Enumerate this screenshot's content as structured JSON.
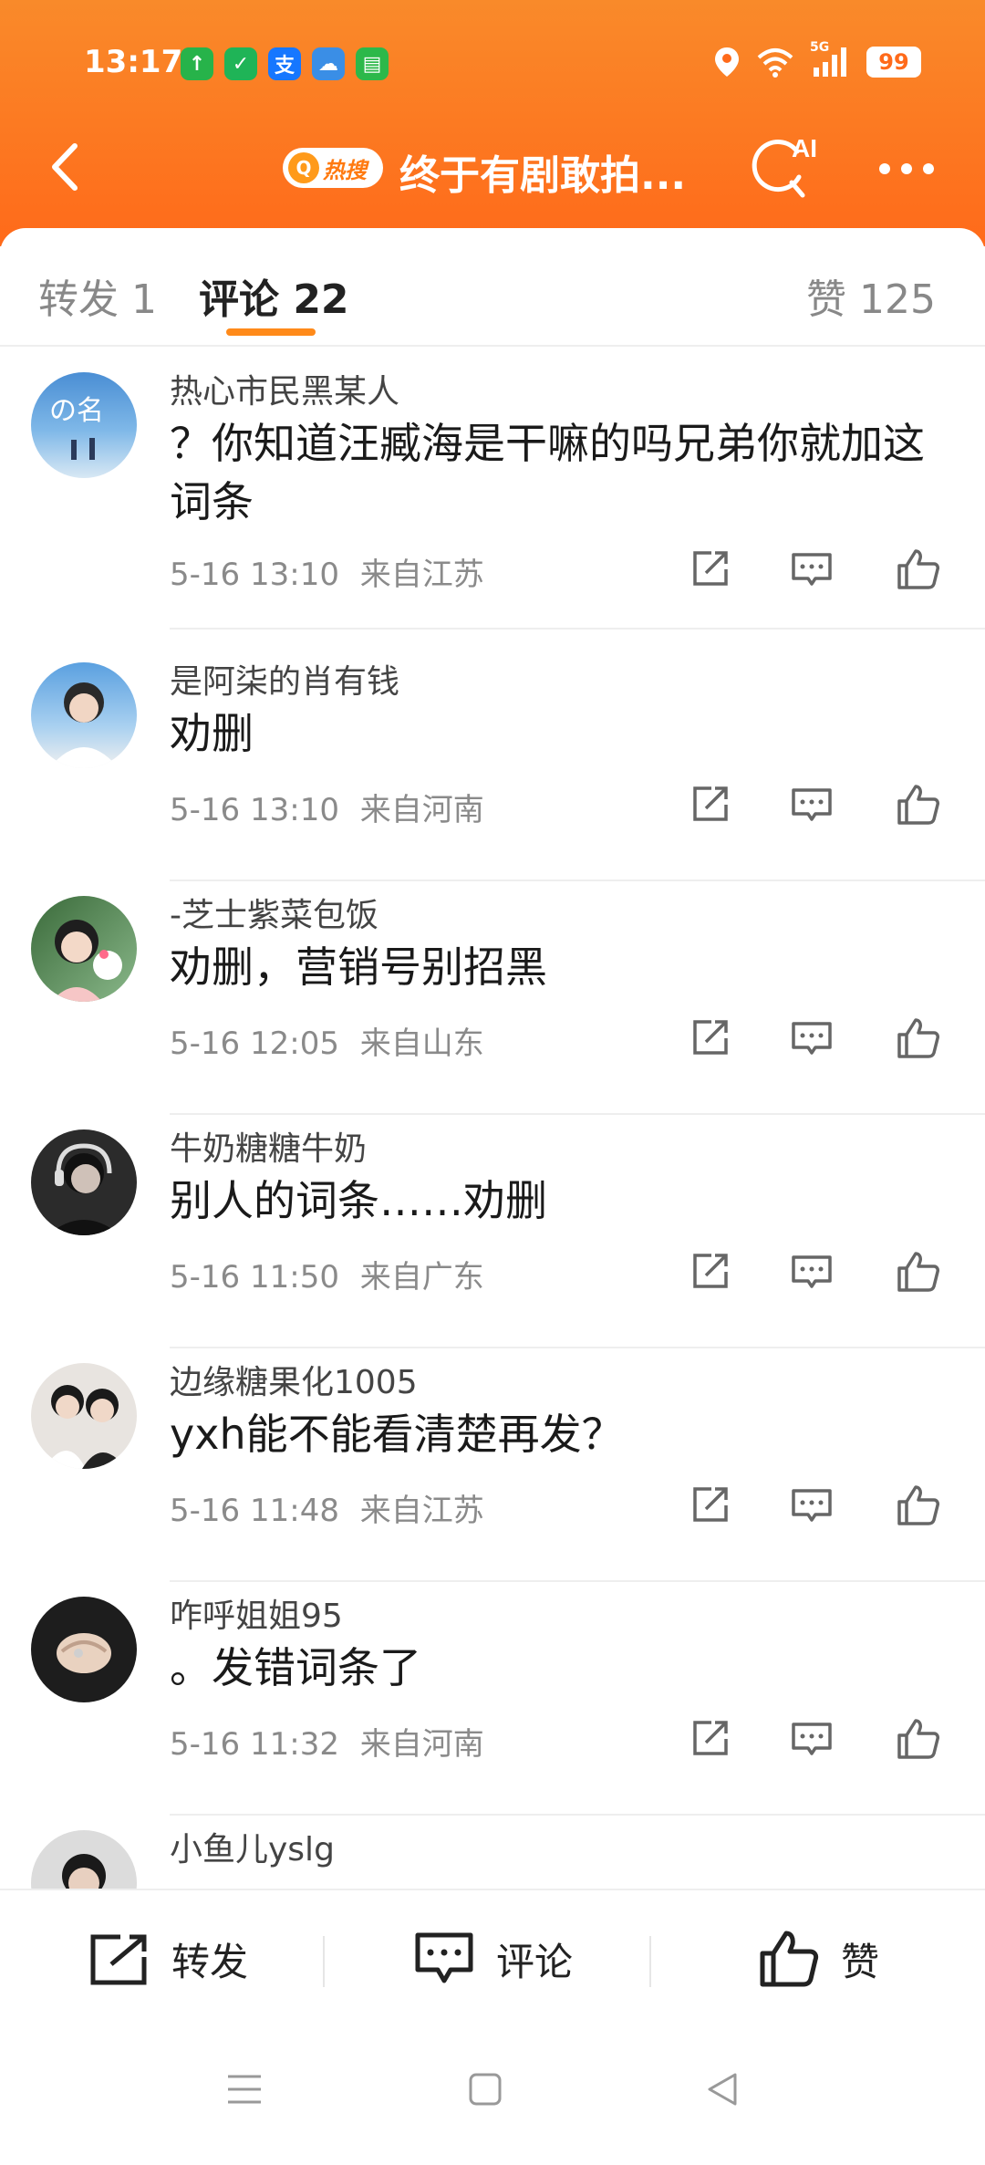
{
  "status_bar": {
    "time": "13:17",
    "battery": "99",
    "network": "5G"
  },
  "nav": {
    "hot_label": "热搜",
    "title": "终于有剧敢拍...",
    "ai_label": "AI"
  },
  "tabs": {
    "repost": "转发 1",
    "comments": "评论 22",
    "likes": "赞 125"
  },
  "comments": [
    {
      "user": "热心市民黑某人",
      "text": "？你知道汪臧海是干嘛的吗兄弟你就加这词条",
      "time": "5-16 13:10",
      "location": "来自江苏"
    },
    {
      "user": "是阿柒的肖有钱",
      "text": "劝删",
      "time": "5-16 13:10",
      "location": "来自河南"
    },
    {
      "user": "-芝士紫菜包饭",
      "text": "劝删，营销号别招黑",
      "time": "5-16 12:05",
      "location": "来自山东"
    },
    {
      "user": "牛奶糖糖牛奶",
      "text": "别人的词条……劝删",
      "time": "5-16 11:50",
      "location": "来自广东"
    },
    {
      "user": "边缘糖果化1005",
      "text": "yxh能不能看清楚再发？",
      "time": "5-16 11:48",
      "location": "来自江苏"
    },
    {
      "user": "咋呼姐姐95",
      "text": "。发错词条了",
      "time": "5-16 11:32",
      "location": "来自河南"
    },
    {
      "user": "小鱼儿yslg",
      "text": "",
      "time": "",
      "location": ""
    }
  ],
  "bottom_bar": {
    "repost": "转发",
    "comment": "评论",
    "like": "赞"
  },
  "colors": {
    "header": "#ff6a1a",
    "accent": "#ff8a1a"
  }
}
